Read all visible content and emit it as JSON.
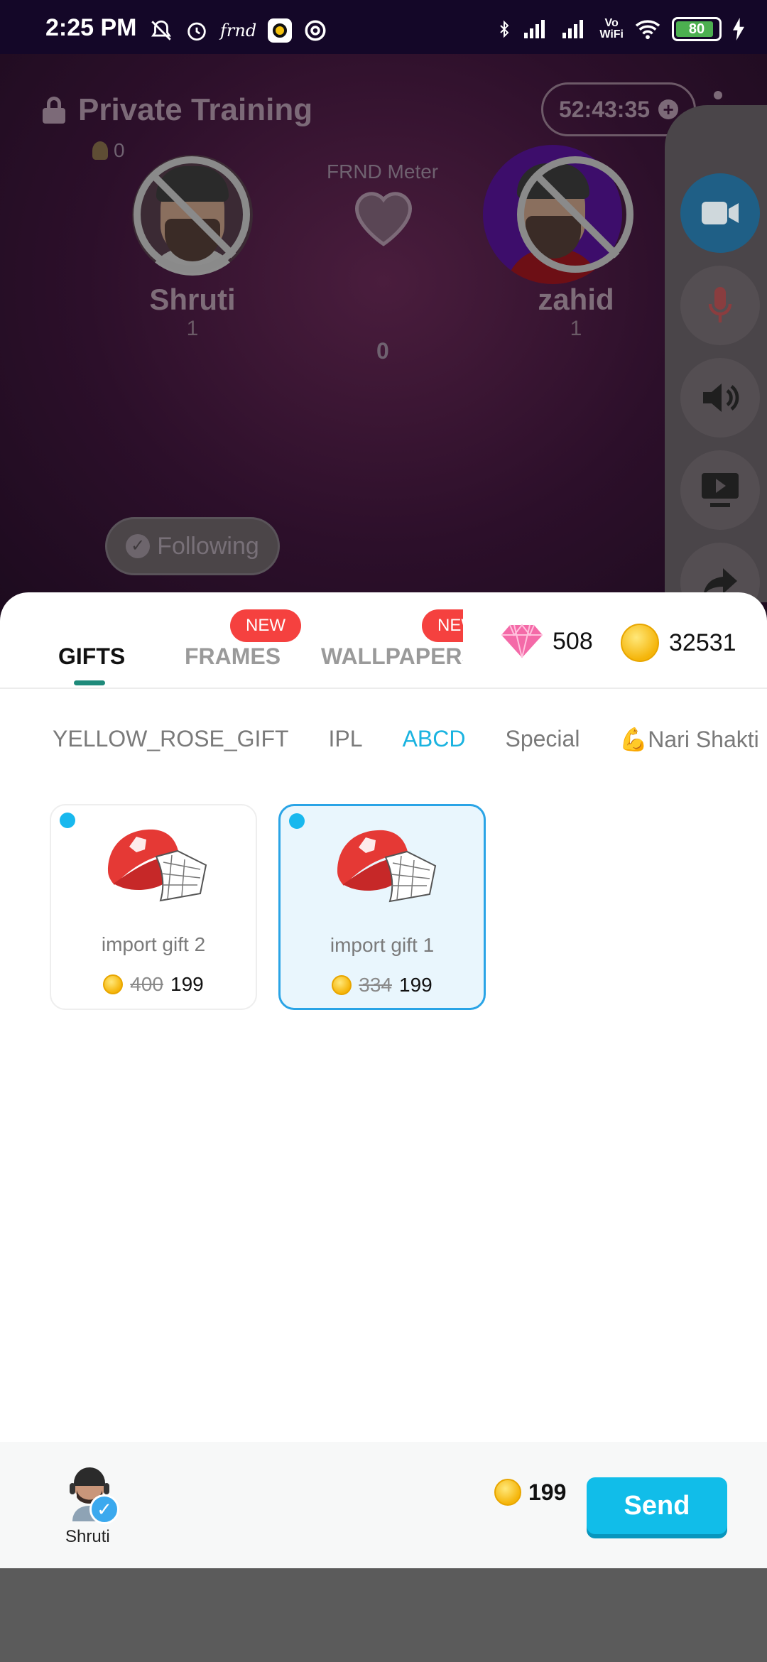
{
  "status_bar": {
    "time": "2:25 PM",
    "battery": "80"
  },
  "room": {
    "title": "Private Training",
    "rose_count": "0",
    "timer": "52:43:35",
    "timer_plus": "+",
    "meter": {
      "label": "FRND Meter",
      "value": "0"
    },
    "users": [
      {
        "name": "Shruti",
        "level": "1",
        "follow_label": "Following"
      },
      {
        "name": "zahid",
        "level": "1"
      }
    ]
  },
  "sheet": {
    "tabs": [
      {
        "label": "GIFTS",
        "badge": ""
      },
      {
        "label": "FRAMES",
        "badge": "NEW"
      },
      {
        "label": "WALLPAPERS",
        "badge": "NEW"
      }
    ],
    "diamonds": "508",
    "coins": "32531",
    "categories": [
      "YELLOW_ROSE_GIFT",
      "IPL",
      "ABCD",
      "Special",
      "Nari Shakti"
    ],
    "category_emoji": "💪",
    "active_category": "ABCD",
    "gifts": [
      {
        "name": "import gift 2",
        "old_price": "400",
        "price": "199",
        "selected": false
      },
      {
        "name": "import gift 1",
        "old_price": "334",
        "price": "199",
        "selected": true
      }
    ]
  },
  "footer": {
    "recipient": "Shruti",
    "cost": "199",
    "send_label": "Send"
  },
  "colors": {
    "accent": "#11bde9",
    "badge": "#f5413f",
    "tab_indicator": "#1e8a7a"
  }
}
